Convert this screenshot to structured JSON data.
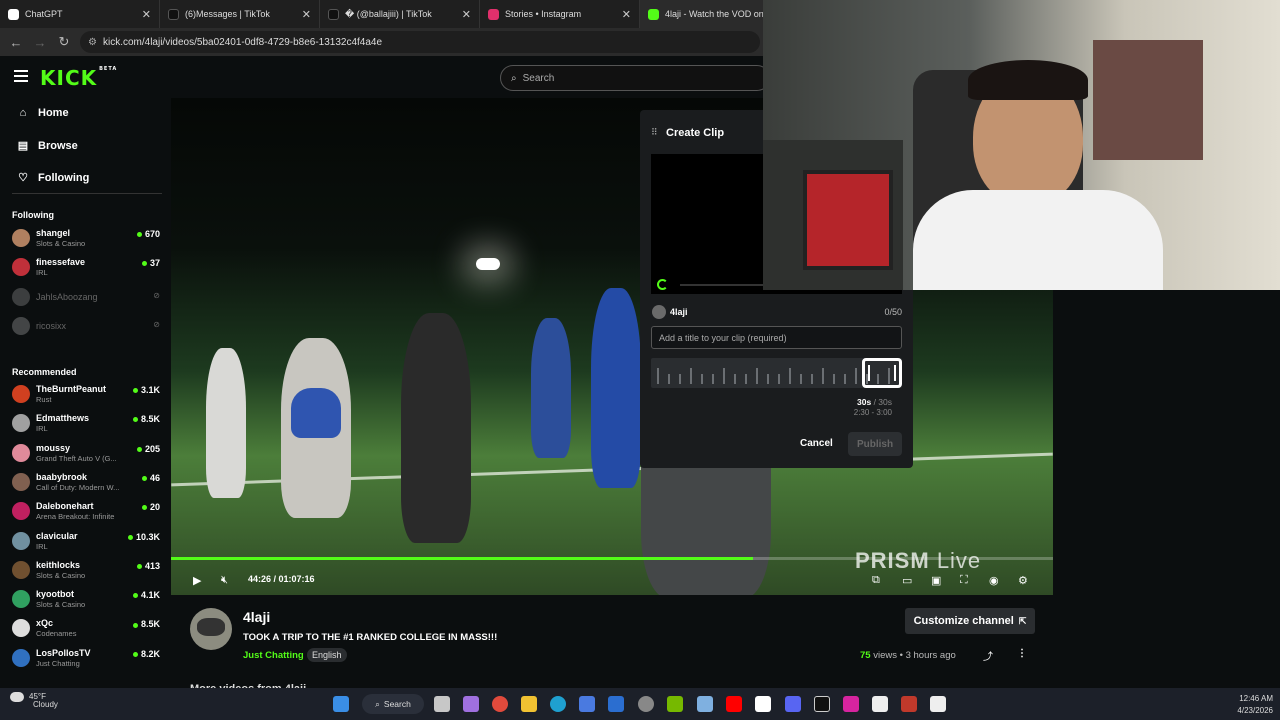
{
  "browser": {
    "tabs": [
      {
        "label": "ChatGPT",
        "color": "#ffffff"
      },
      {
        "label": "(6)Messages | TikTok",
        "color": "#111111"
      },
      {
        "label": "� (@ballajiii) | TikTok",
        "color": "#111111"
      },
      {
        "label": "Stories • Instagram",
        "color": "#e1306c"
      },
      {
        "label": "4laji - Watch the VOD on Kick",
        "color": "#53fc18"
      }
    ],
    "url": "kick.com/4laji/videos/5ba02401-0df8-4729-b8e6-13132c4f4a4e"
  },
  "header": {
    "logo": "KICK",
    "logo_badge": "BETA",
    "search_placeholder": "Search"
  },
  "sidebar": {
    "nav": [
      {
        "label": "Home",
        "icon": "home-icon",
        "glyph": "⌂"
      },
      {
        "label": "Browse",
        "icon": "browse-icon",
        "glyph": "▤"
      },
      {
        "label": "Following",
        "icon": "heart-icon",
        "glyph": "♡"
      }
    ],
    "following_heading": "Following",
    "following": [
      {
        "name": "shangel",
        "category": "Slots & Casino",
        "viewers": "670",
        "color": "#b08060"
      },
      {
        "name": "finessefave",
        "category": "IRL",
        "viewers": "37",
        "color": "#c0303a"
      },
      {
        "name": "JahlsAboozang",
        "category": "",
        "viewers": "",
        "color": "#888888"
      },
      {
        "name": "ricosixx",
        "category": "",
        "viewers": "",
        "color": "#999999"
      }
    ],
    "recommended_heading": "Recommended",
    "recommended": [
      {
        "name": "TheBurntPeanut",
        "category": "Rust",
        "viewers": "3.1K",
        "color": "#d04020"
      },
      {
        "name": "Edmatthews",
        "category": "IRL",
        "viewers": "8.5K",
        "color": "#a0a0a0"
      },
      {
        "name": "moussy",
        "category": "Grand Theft Auto V (G...",
        "viewers": "205",
        "color": "#e08a9a"
      },
      {
        "name": "baabybrook",
        "category": "Call of Duty: Modern W...",
        "viewers": "46",
        "color": "#806050"
      },
      {
        "name": "Dalebonehart",
        "category": "Arena Breakout: Infinite",
        "viewers": "20",
        "color": "#c02060"
      },
      {
        "name": "clavicular",
        "category": "IRL",
        "viewers": "10.3K",
        "color": "#7090a0"
      },
      {
        "name": "keithlocks",
        "category": "Slots & Casino",
        "viewers": "413",
        "color": "#705030"
      },
      {
        "name": "kyootbot",
        "category": "Slots & Casino",
        "viewers": "4.1K",
        "color": "#30a060"
      },
      {
        "name": "xQc",
        "category": "Codenames",
        "viewers": "8.5K",
        "color": "#dddddd"
      },
      {
        "name": "LosPollosTV",
        "category": "Just Chatting",
        "viewers": "8.2K",
        "color": "#3070c0"
      }
    ]
  },
  "player": {
    "time": "44:26 / 01:07:16",
    "progress_fraction": 0.66,
    "watermark_a": "PRISM",
    "watermark_b": "Live"
  },
  "clip": {
    "title": "Create Clip",
    "username": "4laji",
    "char_count": "0/50",
    "title_placeholder": "Add a title to your clip (required)",
    "duration_selected": "30s",
    "duration_max": " / 30s",
    "range": "2:30 - 3:00",
    "cancel_label": "Cancel",
    "publish_label": "Publish"
  },
  "channel": {
    "name": "4laji",
    "video_title": "TOOK A TRIP TO THE #1 RANKED COLLEGE IN MASS!!!",
    "category": "Just Chatting",
    "language": "English",
    "customize_label": "Customize channel",
    "views_count": "75",
    "views_label": " views",
    "age": "3 hours ago",
    "more_videos": "More videos from 4laji"
  },
  "taskbar": {
    "temp": "45°F",
    "weather": "Cloudy",
    "search_label": "Search",
    "time": "12:46 AM",
    "date": "4/23/2026"
  }
}
